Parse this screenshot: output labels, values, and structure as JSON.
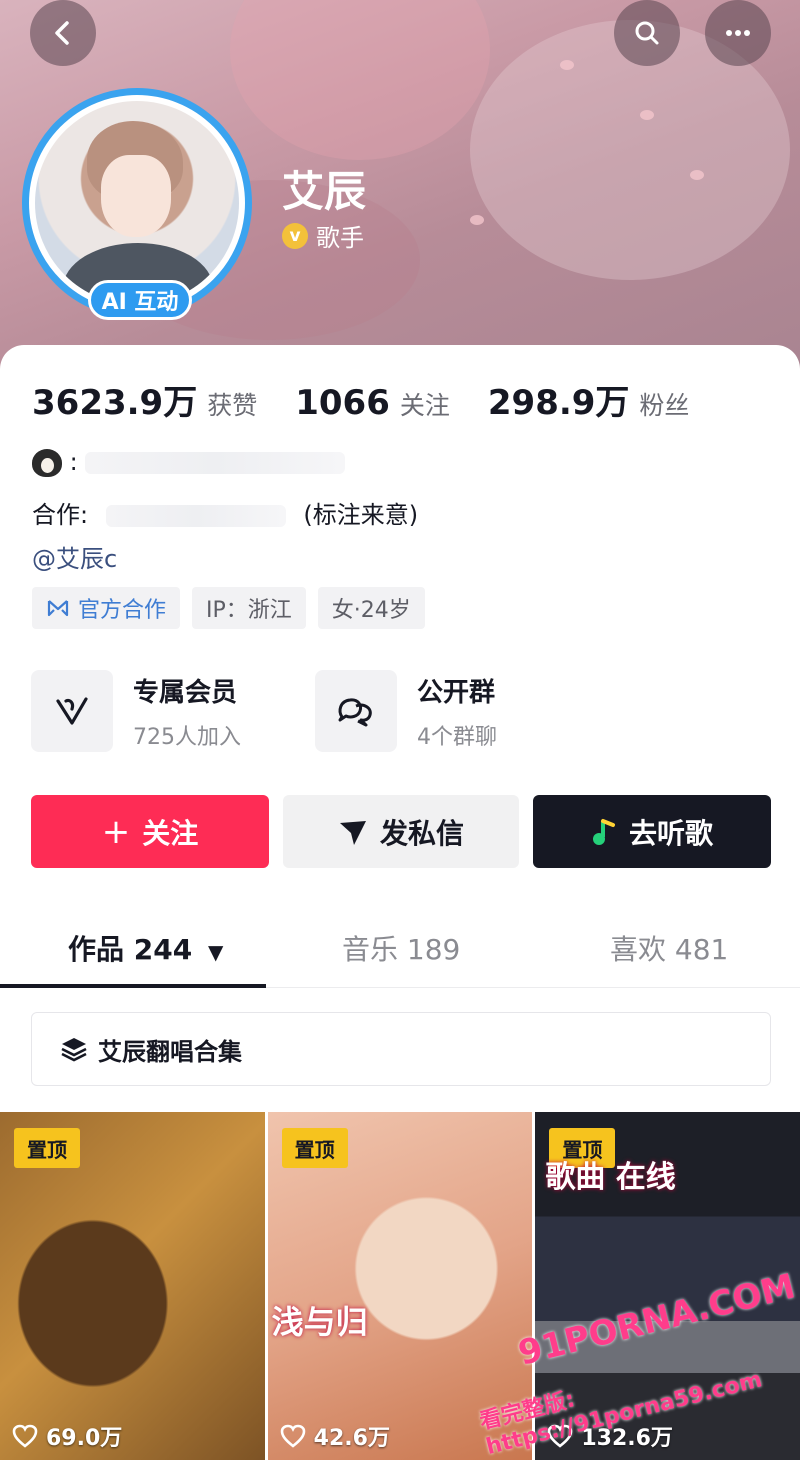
{
  "header": {
    "name": "艾辰",
    "verify_mark": "v",
    "role": "歌手",
    "ai_badge": "AI 互动"
  },
  "stats": [
    {
      "value": "3623.9万",
      "label": "获赞"
    },
    {
      "value": "1066",
      "label": "关注"
    },
    {
      "value": "298.9万",
      "label": "粉丝"
    }
  ],
  "bio": {
    "qq_colon": ":",
    "cooperation_label": "合作:",
    "cooperation_note": "(标注来意)",
    "mention": "@艾辰c"
  },
  "tags": [
    "官方合作",
    "IP：浙江",
    "女·24岁"
  ],
  "features": [
    {
      "title": "专属会员",
      "subtitle": "725人加入"
    },
    {
      "title": "公开群",
      "subtitle": "4个群聊"
    }
  ],
  "actions": {
    "follow": "关注",
    "follow_plus": "+",
    "message": "发私信",
    "listen": "去听歌"
  },
  "tabs": [
    {
      "label": "作品 244",
      "arrow": "▼"
    },
    {
      "label": "音乐 189"
    },
    {
      "label": "喜欢 481"
    }
  ],
  "collection": {
    "label": "艾辰翻唱合集"
  },
  "videos": [
    {
      "pin": "置顶",
      "likes": "69.0万"
    },
    {
      "pin": "置顶",
      "likes": "42.6万",
      "overlay": "浅与归"
    },
    {
      "pin": "置顶",
      "likes": "132.6万",
      "overlay": "歌曲 在线"
    }
  ],
  "watermark": {
    "line1": "91PORNA.COM",
    "line2": "看完整版: https://91porna59.com"
  },
  "colors": {
    "follow": "#fe2c55",
    "listen_bg": "#161823",
    "avatar_ring": "#3aa3ef",
    "pin": "#f6c31e"
  }
}
